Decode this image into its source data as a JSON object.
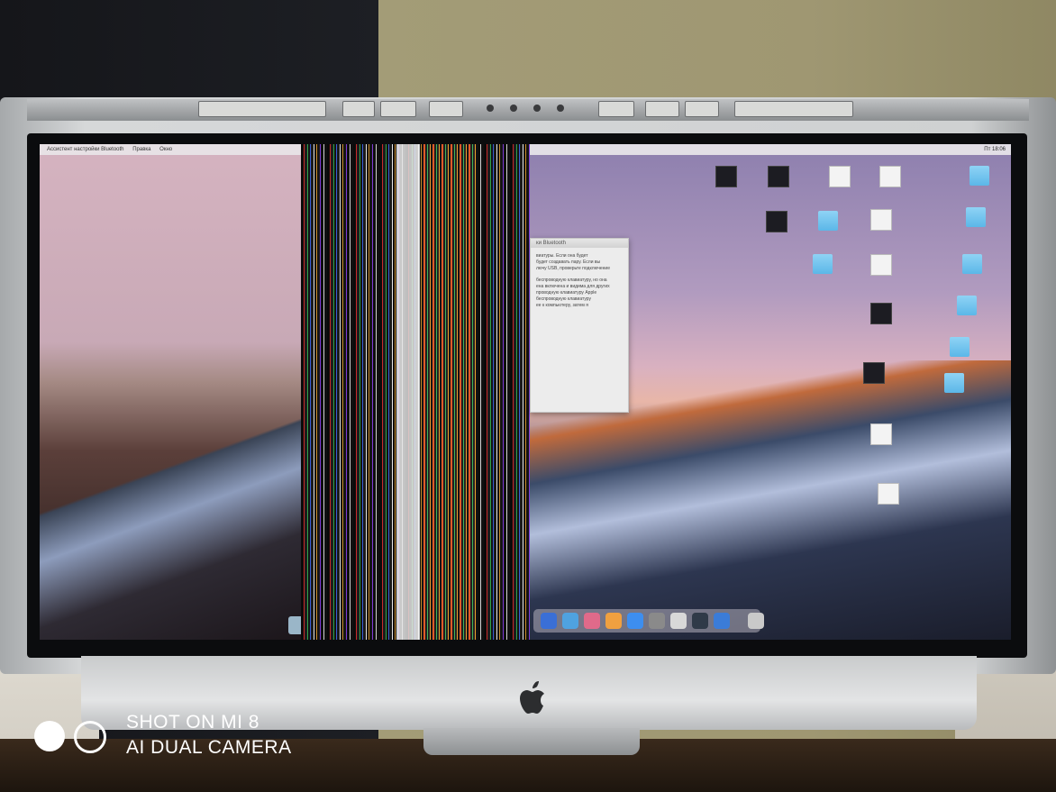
{
  "photo": {
    "subject": "iMac with display showing vertical color stripes and split panels",
    "left_panel_menu": [
      "Ассистент настройки Bluetooth",
      "Правка",
      "Окно"
    ],
    "dialog_title": "ки Bluetooth",
    "dialog_lines": [
      "виатуры. Если она будет",
      "будет создавать пару. Если вы",
      "лючу USB, проверьте подключение",
      "беспроводную клавиатуру, но она",
      "ена включена и видима для других",
      "проводную клавиатуру Apple",
      "беспроводную клавиатуру",
      "ее к компьютеру, затем я"
    ],
    "clock": "Пт 18:06",
    "watermark": {
      "line1": "SHOT ON MI 8",
      "line2": "AI DUAL CAMERA"
    }
  },
  "colors": {
    "wall": "#a39c77",
    "frame": "#cfd1d2",
    "bezel": "#0b0c0e",
    "sky_right": "#b19bbf"
  },
  "icons": [
    "apple-logo-icon",
    "folder-icon",
    "document-icon",
    "dock-icon"
  ]
}
